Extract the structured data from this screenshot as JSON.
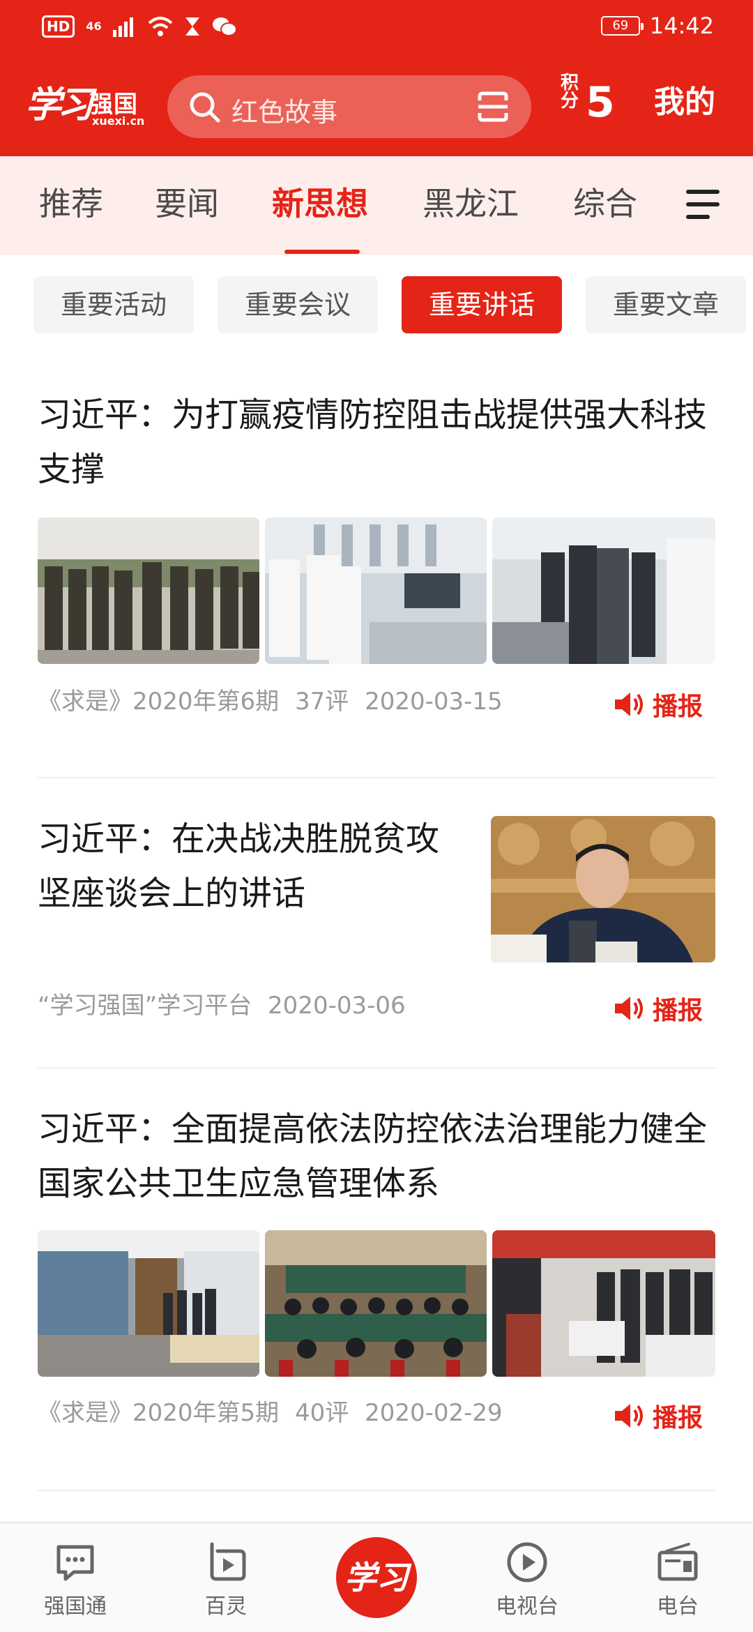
{
  "status_bar": {
    "hd": "HD",
    "network": "46",
    "battery": "69",
    "time": "14:42"
  },
  "header": {
    "logo_text": "学习",
    "logo_subtitle": "强国",
    "logo_url": "xuexi.cn",
    "search_placeholder": "红色故事",
    "points_label": "积分",
    "points_value": "5",
    "mine_label": "我的"
  },
  "tabs": [
    {
      "label": "推荐",
      "active": false
    },
    {
      "label": "要闻",
      "active": false
    },
    {
      "label": "新思想",
      "active": true
    },
    {
      "label": "黑龙江",
      "active": false
    },
    {
      "label": "综合",
      "active": false
    }
  ],
  "chips": [
    {
      "label": "重要活动",
      "active": false
    },
    {
      "label": "重要会议",
      "active": false
    },
    {
      "label": "重要讲话",
      "active": true
    },
    {
      "label": "重要文章",
      "active": false
    }
  ],
  "articles": [
    {
      "title": "习近平：为打赢疫情防控阻击战提供强大科技支撑",
      "source": "《求是》2020年第6期",
      "comments": "37评",
      "date": "2020-03-15",
      "broadcast_label": "播报"
    },
    {
      "title": "习近平：在决战决胜脱贫攻坚座谈会上的讲话",
      "source": "“学习强国”学习平台",
      "comments": "",
      "date": "2020-03-06",
      "broadcast_label": "播报"
    },
    {
      "title": "习近平：全面提高依法防控依法治理能力健全国家公共卫生应急管理体系",
      "source": "《求是》2020年第5期",
      "comments": "40评",
      "date": "2020-02-29",
      "broadcast_label": "播报"
    }
  ],
  "bottom_nav": {
    "items": [
      {
        "label": "强国通",
        "icon": "chat-icon"
      },
      {
        "label": "百灵",
        "icon": "play-square-icon"
      },
      {
        "label": "学习",
        "icon": "xuexi-logo-icon"
      },
      {
        "label": "电视台",
        "icon": "play-circle-icon"
      },
      {
        "label": "电台",
        "icon": "radio-icon"
      }
    ]
  },
  "colors": {
    "brand_red": "#e42417",
    "tab_bar_bg": "#fdeeec",
    "meta_gray": "#9a9a9a"
  }
}
